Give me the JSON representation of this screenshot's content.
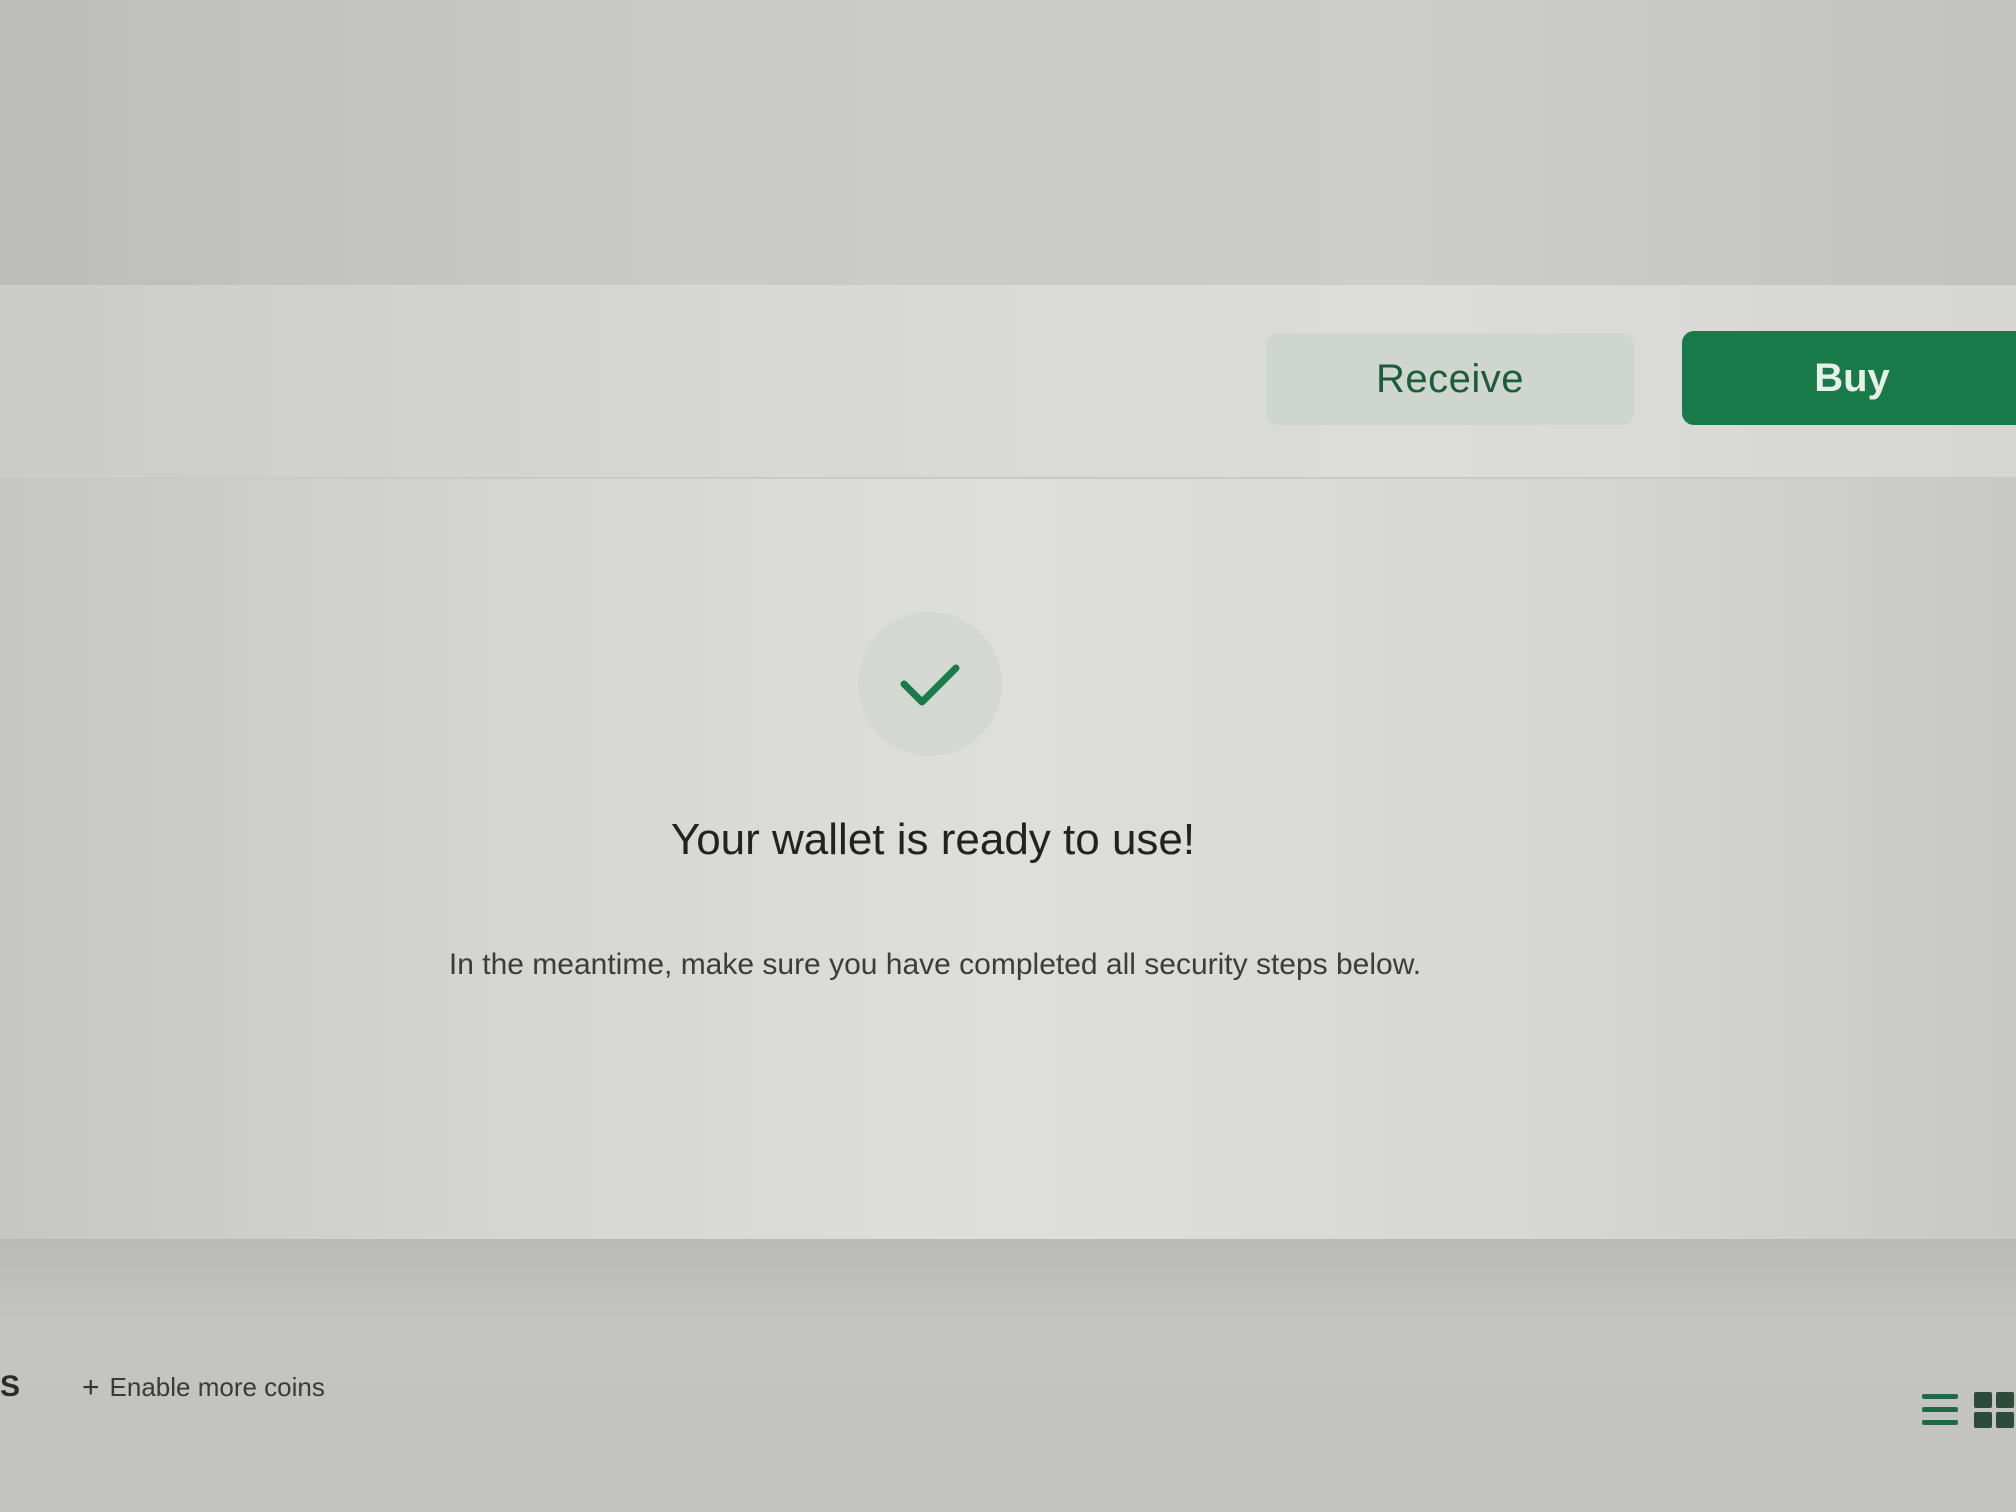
{
  "actions": {
    "receive_label": "Receive",
    "buy_label": "Buy"
  },
  "status": {
    "title": "Your wallet is ready to use!",
    "message": "In the meantime, make sure you have completed all security steps below.",
    "icon": "checkmark-icon"
  },
  "coins_section": {
    "tab_fragment": "S",
    "enable_more_label": "Enable more coins",
    "view_icons": [
      "list-view-icon",
      "grid-view-icon"
    ]
  },
  "colors": {
    "brand_green": "#187a48",
    "receive_bg": "#cfd6cf",
    "check_green": "#1a7a4a"
  }
}
